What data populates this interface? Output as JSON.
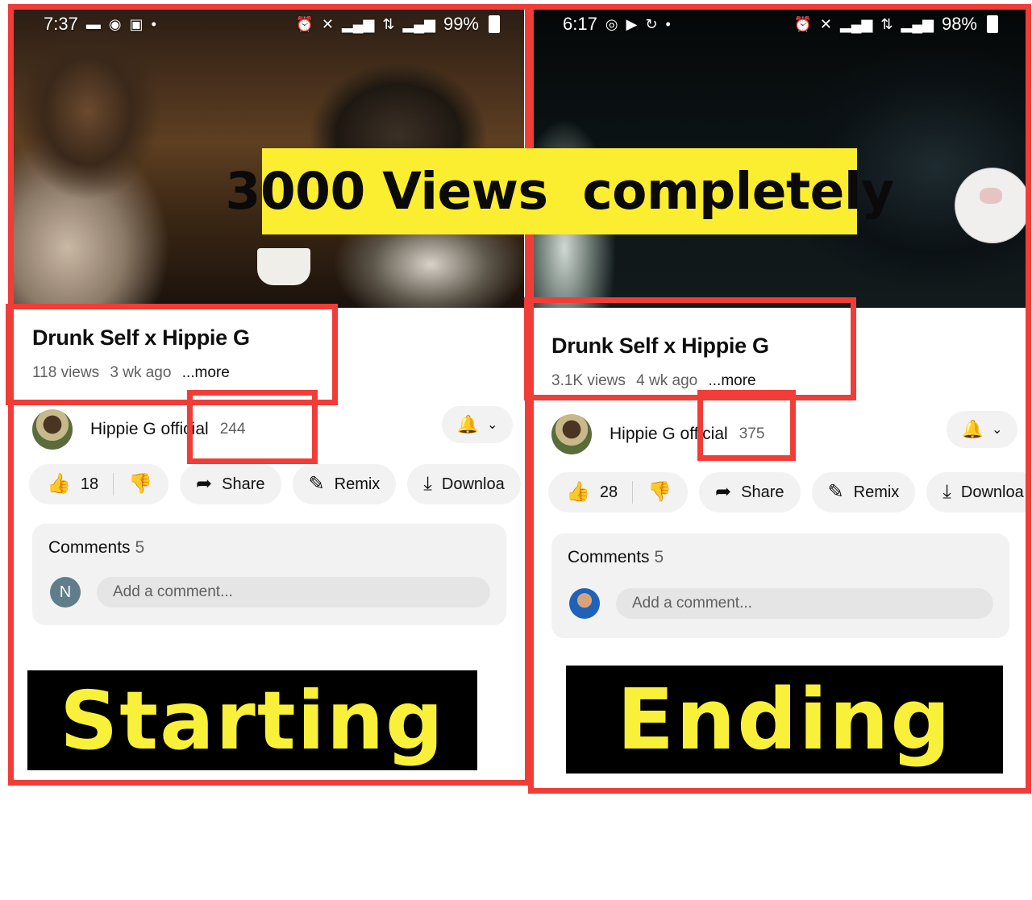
{
  "headline": "3000 Views  completely",
  "colors": {
    "highlight_red": "#f03d37",
    "headline_yellow": "#fbed2f",
    "label_yellow": "#f9f03a"
  },
  "left": {
    "status": {
      "time": "7:37",
      "battery": "99%",
      "left_icons": [
        "message-icon",
        "app-icon",
        "v-app-icon",
        "dot"
      ],
      "right_icons": [
        "alarm-icon",
        "mute-icon",
        "signal-icon",
        "4g-icon",
        "signal-icon"
      ]
    },
    "video": {
      "title": "Drunk Self x Hippie G",
      "views": "118 views",
      "age": "3 wk ago",
      "more": "...more"
    },
    "channel": {
      "name": "Hippie G official",
      "subscribers": "244"
    },
    "actions": {
      "likes": "18",
      "share": "Share",
      "remix": "Remix",
      "download": "Downloa"
    },
    "comments": {
      "label": "Comments",
      "count": "5",
      "avatar_initial": "N",
      "placeholder": "Add a comment..."
    },
    "caption": "Starting"
  },
  "right": {
    "status": {
      "time": "6:17",
      "battery": "98%",
      "left_icons": [
        "instagram-icon",
        "youtube-icon",
        "sync-icon",
        "dot"
      ],
      "right_icons": [
        "alarm-icon",
        "mute-icon",
        "signal-icon",
        "4g-icon",
        "signal-icon"
      ]
    },
    "video": {
      "title": "Drunk Self x Hippie G",
      "views": "3.1K views",
      "age": "4 wk ago",
      "more": "...more"
    },
    "channel": {
      "name": "Hippie G official",
      "subscribers": "375"
    },
    "actions": {
      "likes": "28",
      "share": "Share",
      "remix": "Remix",
      "download": "Downloa"
    },
    "comments": {
      "label": "Comments",
      "count": "5",
      "placeholder": "Add a comment..."
    },
    "caption": "Ending"
  }
}
